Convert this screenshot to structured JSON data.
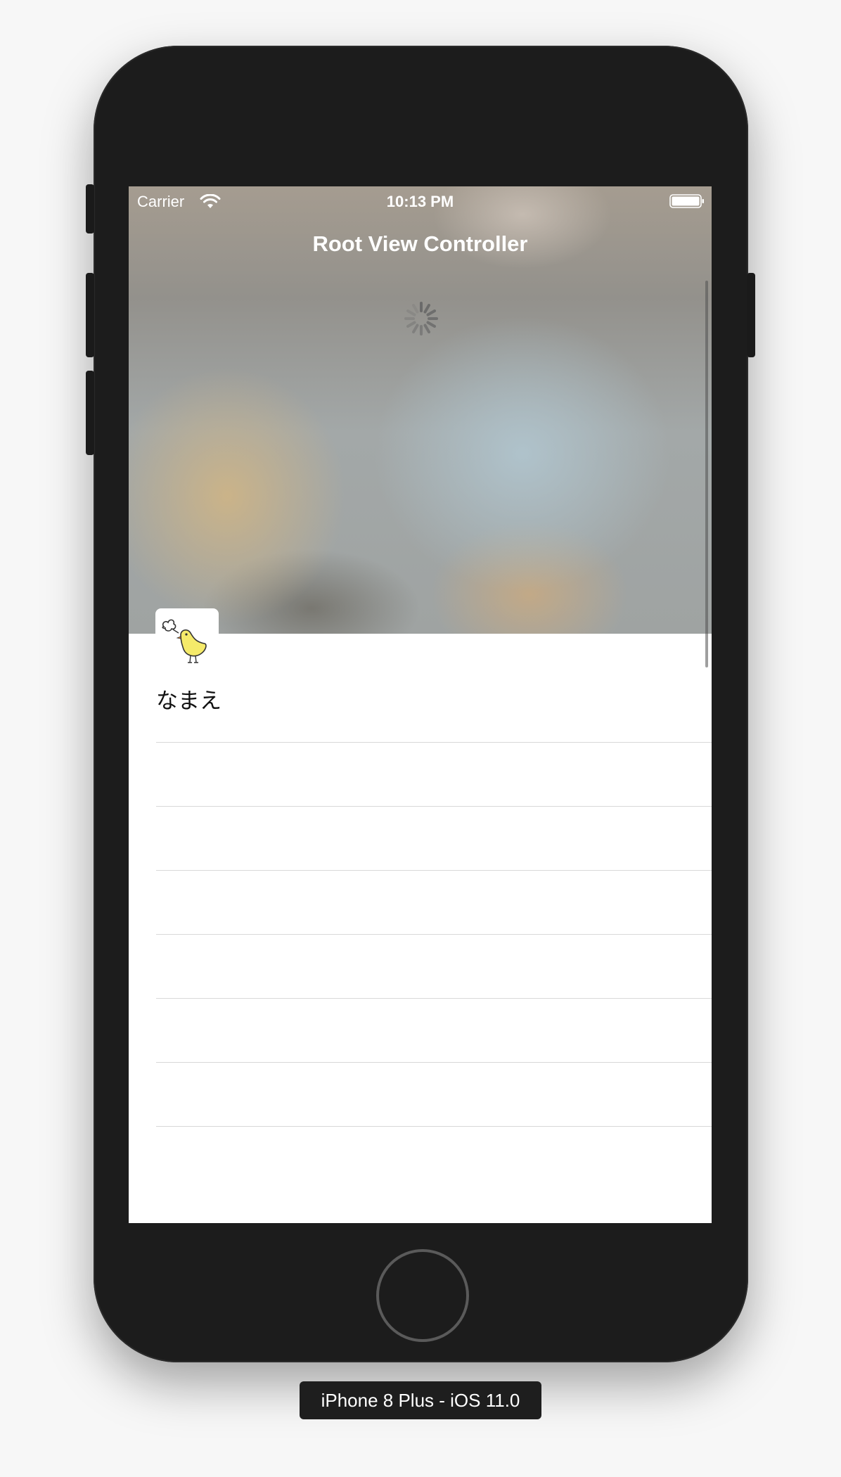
{
  "status_bar": {
    "carrier": "Carrier",
    "time": "10:13 PM",
    "wifi_icon": "wifi-icon",
    "battery_icon": "battery-icon"
  },
  "navigation": {
    "title": "Root View Controller"
  },
  "loading": {
    "icon": "activity-spinner-icon"
  },
  "profile": {
    "avatar_icon": "chick-icon",
    "name": "なまえ"
  },
  "table": {
    "rows": [
      "",
      "",
      "",
      "",
      "",
      "",
      ""
    ]
  },
  "simulator": {
    "device_label": "iPhone 8 Plus - iOS 11.0"
  },
  "colors": {
    "device_body": "#1c1c1c",
    "separator": "#d8d8d8",
    "chick": "#f5ea6a"
  }
}
